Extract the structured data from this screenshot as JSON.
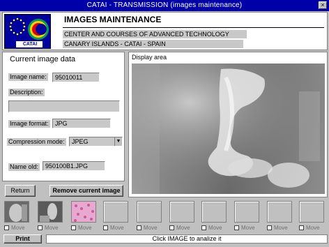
{
  "window": {
    "title": "CATAI - TRANSMISSION (images maintenance)",
    "close_glyph": "×"
  },
  "header": {
    "title": "IMAGES MAINTENANCE",
    "subtitle_1": "CENTER AND COURSES OF ADVANCED TECHNOLOGY",
    "subtitle_2": "CANARY ISLANDS - CATAI - SPAIN",
    "logo_text": "CATAI"
  },
  "current_image": {
    "heading": "Current image data",
    "image_name_label": "Image name:",
    "image_name_value": "95010011",
    "description_label": "Description:",
    "description_value": "",
    "image_format_label": "Image format:",
    "image_format_value": "JPG",
    "compression_label": "Compression mode:",
    "compression_value": "JPEG",
    "name_old_label": "Name old:",
    "name_old_value": "950100B1.JPG"
  },
  "display": {
    "label": "Display area"
  },
  "buttons": {
    "return_label": "Return",
    "remove_label": "Remove current image",
    "print_label": "Print"
  },
  "thumbnails": [
    {
      "move_label": "Move",
      "kind": "xray"
    },
    {
      "move_label": "Move",
      "kind": "xray"
    },
    {
      "move_label": "Move",
      "kind": "tissue"
    },
    {
      "move_label": "Move",
      "kind": "empty"
    },
    {
      "move_label": "Move",
      "kind": "empty"
    },
    {
      "move_label": "Move",
      "kind": "empty"
    },
    {
      "move_label": "Move",
      "kind": "empty"
    },
    {
      "move_label": "Move",
      "kind": "empty"
    },
    {
      "move_label": "Move",
      "kind": "empty"
    },
    {
      "move_label": "Move",
      "kind": "empty"
    }
  ],
  "status": {
    "text": "Click IMAGE to analize it"
  },
  "colors": {
    "titlebar": "#0000a8",
    "face": "#c0c0c0",
    "field": "#c8c8c8"
  }
}
